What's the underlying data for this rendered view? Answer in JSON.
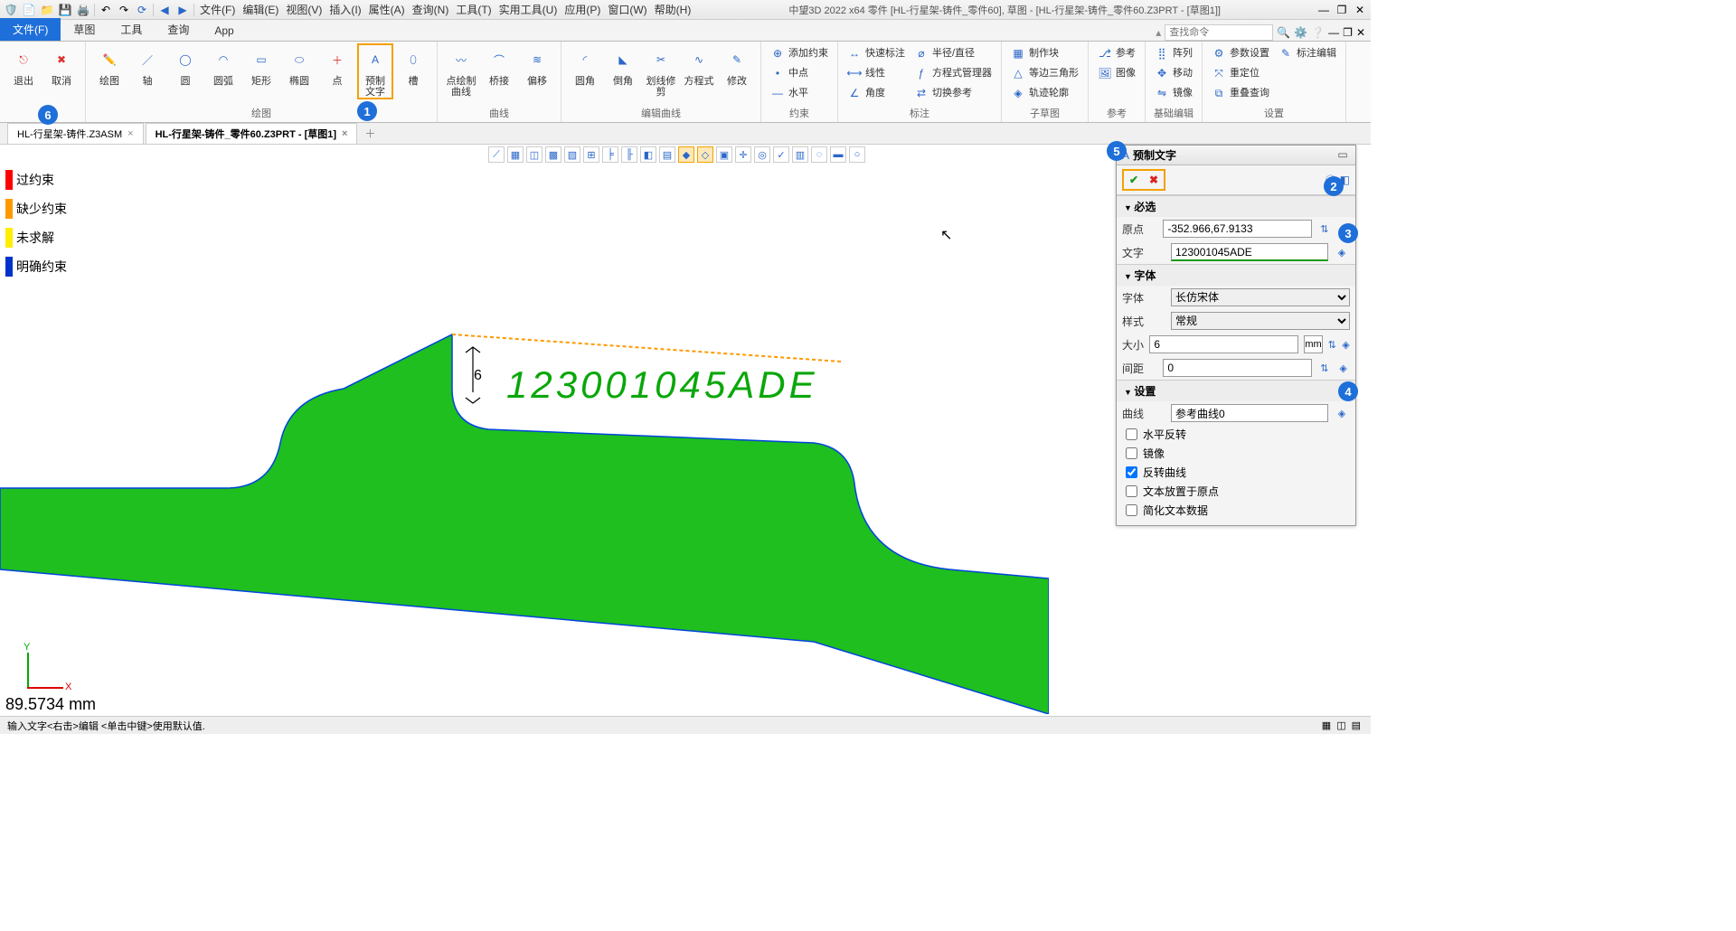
{
  "title_center": "中望3D 2022 x64       零件 [HL-行星架-铸件_零件60],  草图 - [HL-行星架-铸件_零件60.Z3PRT - [草图1]]",
  "menu": [
    "文件(F)",
    "编辑(E)",
    "视图(V)",
    "插入(I)",
    "属性(A)",
    "查询(N)",
    "工具(T)",
    "实用工具(U)",
    "应用(P)",
    "窗口(W)",
    "帮助(H)"
  ],
  "search_placeholder": "查找命令",
  "ribbon_tabs": [
    "文件(F)",
    "草图",
    "工具",
    "查询",
    "App"
  ],
  "ribbon_groups": {
    "g1": {
      "label": "",
      "items": [
        {
          "l": "退出"
        },
        {
          "l": "取消"
        }
      ]
    },
    "g2": {
      "label": "绘图",
      "items": [
        {
          "l": "绘图"
        },
        {
          "l": "轴"
        },
        {
          "l": "圆"
        },
        {
          "l": "圆弧"
        },
        {
          "l": "矩形"
        },
        {
          "l": "椭圆"
        },
        {
          "l": "点"
        },
        {
          "l": "预制文字"
        },
        {
          "l": "槽"
        }
      ]
    },
    "g3": {
      "label": "曲线",
      "items": [
        {
          "l": "点绘制曲线"
        },
        {
          "l": "桥接"
        },
        {
          "l": "偏移"
        }
      ]
    },
    "g4": {
      "label": "编辑曲线",
      "items": [
        {
          "l": "圆角"
        },
        {
          "l": "倒角"
        },
        {
          "l": "划线修剪"
        },
        {
          "l": "方程式"
        },
        {
          "l": "修改"
        }
      ]
    },
    "g5": {
      "label": "约束",
      "cols": [
        [
          {
            "l": "添加约束"
          },
          {
            "l": "中点"
          },
          {
            "l": "水平"
          }
        ]
      ]
    },
    "g6": {
      "label": "标注",
      "cols": [
        [
          {
            "l": "快速标注"
          },
          {
            "l": "线性"
          },
          {
            "l": "角度"
          }
        ],
        [
          {
            "l": "半径/直径"
          },
          {
            "l": "方程式管理器"
          },
          {
            "l": "切换参考"
          }
        ]
      ]
    },
    "g7": {
      "label": "子草图",
      "cols": [
        [
          {
            "l": "制作块"
          },
          {
            "l": "等边三角形"
          },
          {
            "l": "轨迹轮廓"
          }
        ]
      ]
    },
    "g8": {
      "label": "参考",
      "cols": [
        [
          {
            "l": "参考"
          },
          {
            "l": "图像"
          }
        ]
      ]
    },
    "g9": {
      "label": "基础编辑",
      "cols": [
        [
          {
            "l": "阵列"
          },
          {
            "l": "移动"
          },
          {
            "l": "镜像"
          }
        ]
      ]
    },
    "g10": {
      "label": "设置",
      "cols": [
        [
          {
            "l": "参数设置"
          },
          {
            "l": "重定位"
          },
          {
            "l": "重叠查询"
          }
        ],
        [
          {
            "l": "标注编辑"
          }
        ]
      ]
    }
  },
  "doc_tabs": [
    "HL-行星架-铸件.Z3ASM",
    "HL-行星架-铸件_零件60.Z3PRT - [草图1]"
  ],
  "legend": [
    {
      "c": "#ff0000",
      "t": "过约束"
    },
    {
      "c": "#ff9900",
      "t": "缺少约束"
    },
    {
      "c": "#ffee00",
      "t": "未求解"
    },
    {
      "c": "#0033cc",
      "t": "明确约束"
    }
  ],
  "canvas_text": "123001045ADE",
  "canvas_dim": "6",
  "readout": "89.5734 mm",
  "panel": {
    "title": "预制文字",
    "required_label": "必选",
    "origin_label": "原点",
    "origin_value": "-352.966,67.9133",
    "text_label": "文字",
    "text_value": "123001045ADE",
    "font_section": "字体",
    "font_label": "字体",
    "font_value": "长仿宋体",
    "style_label": "样式",
    "style_value": "常规",
    "size_label": "大小",
    "size_value": "6",
    "size_unit": "mm",
    "spacing_label": "间距",
    "spacing_value": "0",
    "settings_section": "设置",
    "curve_label": "曲线",
    "curve_value": "参考曲线0",
    "chk_hflip": "水平反转",
    "chk_mirror": "镜像",
    "chk_revcurve": "反转曲线",
    "chk_text_at_origin": "文本放置于原点",
    "chk_simplify": "简化文本数据"
  },
  "status": "输入文字<右击>编辑  <单击中键>使用默认值.",
  "axis": {
    "x": "X",
    "y": "Y"
  }
}
